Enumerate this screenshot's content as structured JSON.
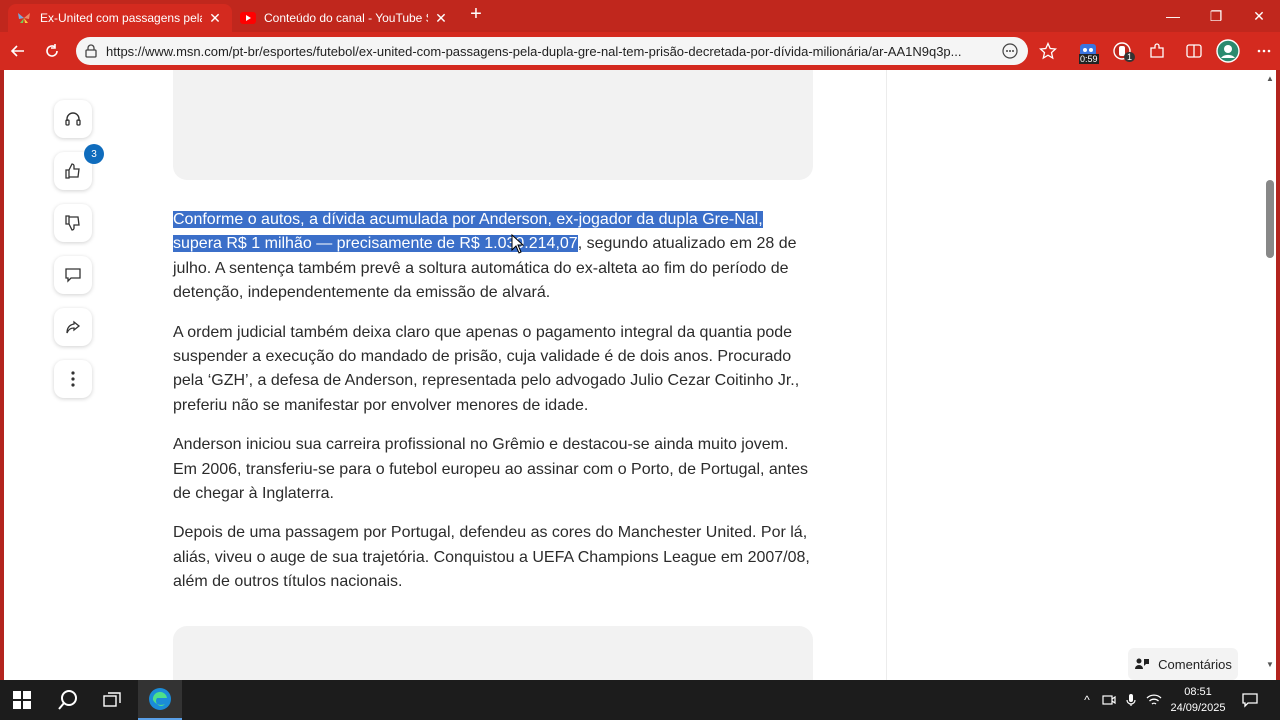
{
  "tabs": [
    {
      "title": "Ex-United com passagens pela du",
      "active": true,
      "favicon": "msn-butterfly-icon"
    },
    {
      "title": "Conteúdo do canal - YouTube Stu",
      "active": false,
      "favicon": "youtube-icon"
    }
  ],
  "address_bar": {
    "url": "https://www.msn.com/pt-br/esportes/futebol/ex-united-com-passagens-pela-dupla-gre-nal-tem-prisão-decretada-por-dívida-milionária/ar-AA1N9q3p..."
  },
  "extensions": {
    "timer_badge": "0:59",
    "notif_badge": "1"
  },
  "rail": {
    "likes_count": "3"
  },
  "article": {
    "p1_highlight": "Conforme o autos, a dívida acumulada por Anderson, ex-jogador da dupla Gre-Nal, supera R$ 1 milhão — precisamente de R$ 1.030.214,07",
    "p1_rest": ", segundo atualizado em 28 de julho. A sentença também prevê a soltura automática do ex-alteta ao fim do período de detenção, independentemente da emissão de alvará.",
    "p2": "A ordem judicial também deixa claro que apenas o pagamento integral da quantia pode suspender a execução do mandado de prisão, cuja validade é de dois anos. Procurado pela ‘GZH’, a defesa de Anderson, representada pelo advogado Julio Cezar Coitinho Jr., preferiu não se manifestar por envolver menores de idade.",
    "p3": "Anderson iniciou sua carreira profissional no Grêmio e destacou-se ainda muito jovem. Em 2006, transferiu-se para o futebol europeu ao assinar com o Porto, de Portugal, antes de chegar à Inglaterra.",
    "p4": "Depois de uma passagem por Portugal, defendeu as cores do Manchester United. Por lá, aliás, viveu o auge de sua trajetória. Conquistou a UEFA Champions League em 2007/08, além de outros títulos nacionais."
  },
  "comments_button": "Comentários",
  "taskbar": {
    "time": "08:51",
    "date": "24/09/2025"
  },
  "colors": {
    "browser_frame": "#c0271d",
    "selection": "#3b6fc9",
    "badge": "#0f6cbd"
  }
}
